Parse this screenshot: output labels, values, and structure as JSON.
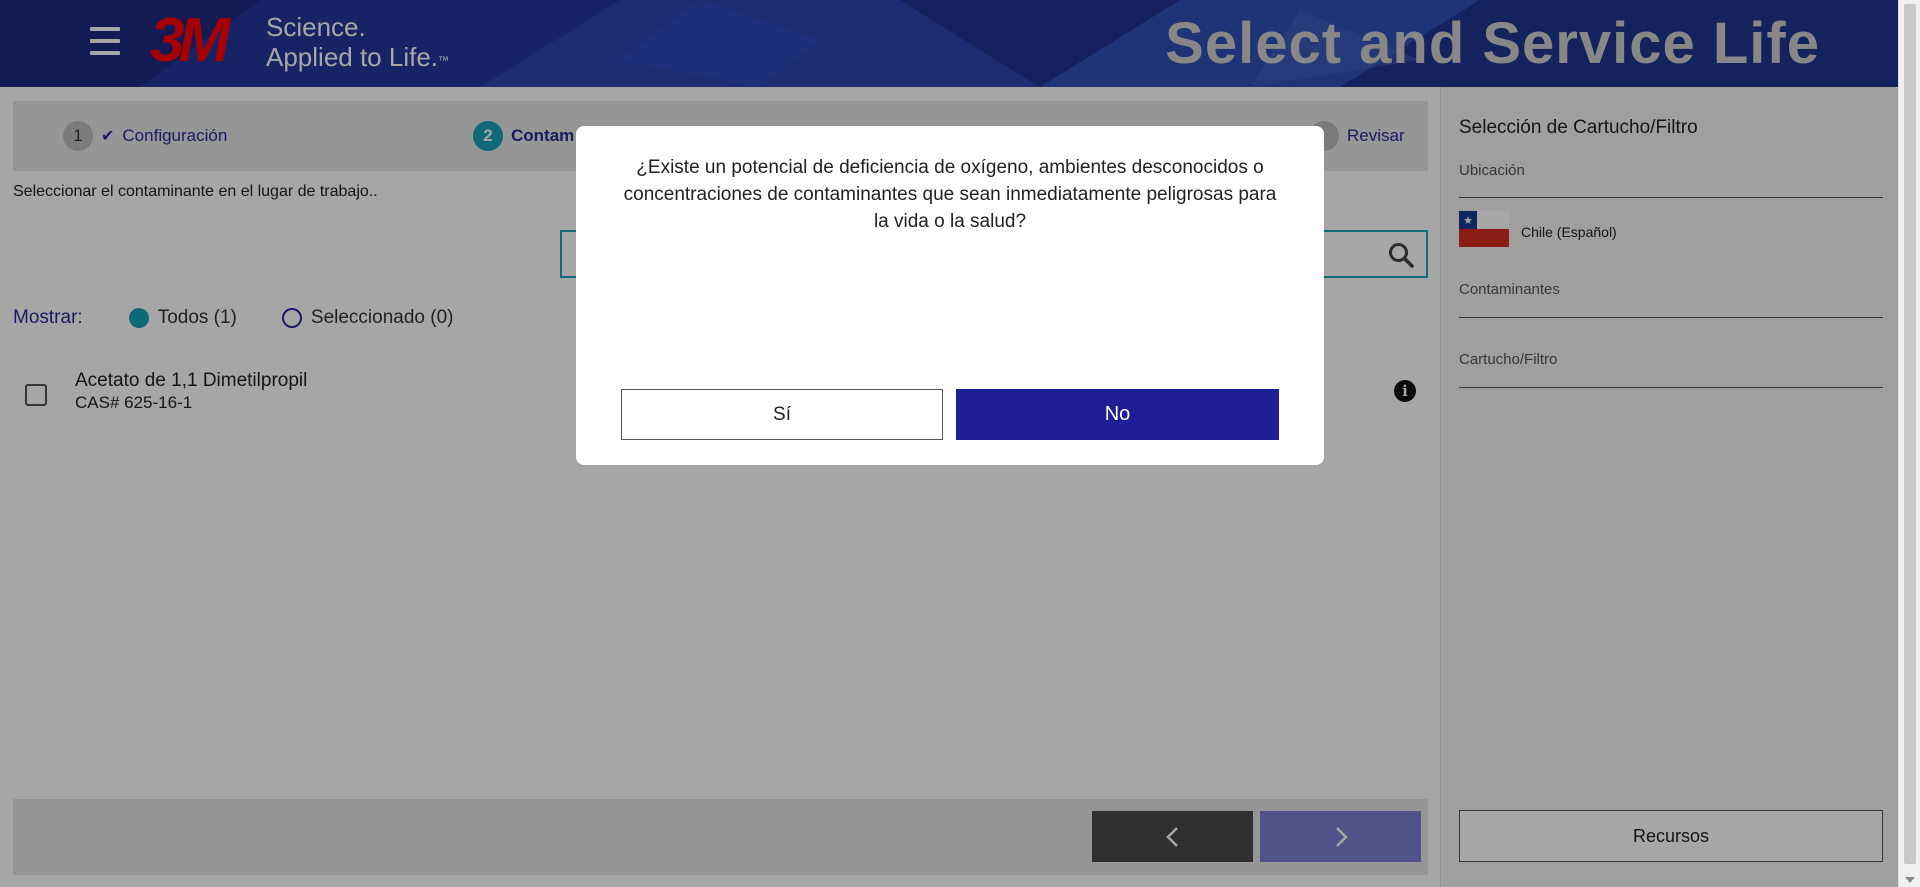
{
  "header": {
    "logo_text": "3M",
    "tagline_line1": "Science.",
    "tagline_line2": "Applied to Life.",
    "tagline_tm": "™",
    "app_title": "Select and Service Life",
    "menu_icon": "hamburger-icon"
  },
  "stepper": {
    "steps": [
      {
        "number": "1",
        "label": "Configuración",
        "status": "completed",
        "icon": "check-icon"
      },
      {
        "number": "2",
        "label": "Contam",
        "status": "active"
      },
      {
        "number": "",
        "label": "Revisar",
        "status": "pending"
      }
    ]
  },
  "main": {
    "instruction": "Seleccionar el contaminante en el lugar de trabajo..",
    "search": {
      "value": "",
      "icon": "search-icon"
    },
    "filter": {
      "label": "Mostrar:",
      "options": [
        {
          "label": "Todos (1)",
          "selected": true
        },
        {
          "label": "Seleccionado (0)",
          "selected": false
        }
      ]
    },
    "items": [
      {
        "name": "Acetato de 1,1 Dimetilpropil",
        "cas": "CAS# 625-16-1",
        "checked": false,
        "info_icon": "info-icon"
      }
    ],
    "nav": {
      "prev_icon": "chevron-left-icon",
      "next_icon": "chevron-right-icon"
    }
  },
  "sidebar": {
    "title": "Selección de Cartucho/Filtro",
    "location_label": "Ubicación",
    "location_value": "Chile (Español)",
    "flag_icon": "chile-flag-icon",
    "contaminants_label": "Contaminantes",
    "cartridge_label": "Cartucho/Filtro",
    "resources_button": "Recursos"
  },
  "modal": {
    "question": "¿Existe un potencial de deficiencia de oxígeno, ambientes desconocidos o concentraciones de contaminantes que sean inmediatamente peligrosas para la vida o la salud?",
    "yes_label": "Sí",
    "no_label": "No"
  },
  "colors": {
    "brand_blue": "#1e2f8e",
    "accent_teal": "#1aa1b5",
    "primary_button": "#1e1e96",
    "logo_red": "#ff0000"
  }
}
